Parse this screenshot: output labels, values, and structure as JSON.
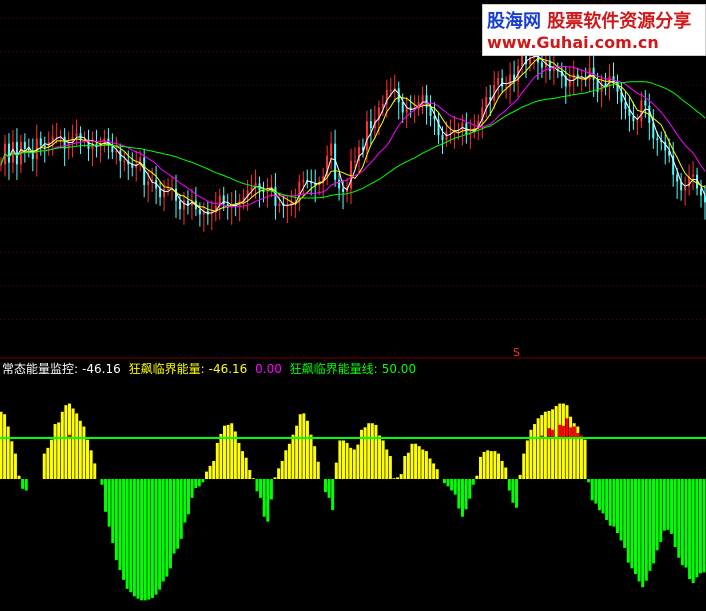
{
  "watermark": {
    "brand": "股海网",
    "tagline": "股票软件资源分享",
    "url": "www.Guhai.com.cn"
  },
  "signal_mark": "S",
  "legend": {
    "monitor_label": "常态能量监控:",
    "monitor_value": "-46.16",
    "critical_label": "狂飙临界能量:",
    "critical_value": "-46.16",
    "extra_value": "0.00",
    "line_label": "狂飙临界能量线:",
    "line_value": "50.00"
  },
  "colors": {
    "background": "#000000",
    "up_candle": "#ff3232",
    "down_candle": "#54ffff",
    "ma_short": "#ffffff",
    "ma_mid": "#ffff00",
    "ma_long1": "#ff00ff",
    "ma_long2": "#00ff00",
    "grid": "#5a0000",
    "positive_bar": "#ffff00",
    "negative_bar": "#00ff00",
    "exceed_bar": "#ff0000",
    "threshold_line": "#00ff00",
    "legend_monitor": "#ffffff",
    "legend_critical": "#ffff00",
    "legend_extra": "#ff00ff",
    "legend_line": "#00ff00"
  },
  "chart_data": [
    {
      "type": "candlestick",
      "title": "",
      "grid": true,
      "series": [
        {
          "name": "",
          "values": [
            76,
            100,
            78,
            102,
            76,
            102,
            94,
            92,
            82,
            106,
            98,
            96,
            102,
            108,
            108,
            108,
            94,
            102,
            108,
            112,
            104,
            104,
            94,
            100,
            96,
            100,
            106,
            98,
            90,
            92,
            80,
            80,
            76,
            72,
            76,
            84,
            52,
            56,
            58,
            48,
            38,
            48,
            48,
            48,
            34,
            24,
            34,
            28,
            34,
            24,
            18,
            22,
            18,
            20,
            28,
            40,
            30,
            26,
            30,
            28,
            34,
            38,
            46,
            50,
            54,
            46,
            44,
            48,
            50,
            28,
            30,
            28,
            28,
            32,
            32,
            56,
            58,
            56,
            54,
            52,
            54,
            62,
            86,
            100,
            58,
            48,
            44,
            48,
            80,
            80,
            96,
            92,
            126,
            118,
            128,
            142,
            146,
            162,
            162,
            164,
            148,
            136,
            142,
            140,
            140,
            148,
            156,
            142,
            132,
            128,
            110,
            104,
            114,
            114,
            116,
            116,
            124,
            110,
            114,
            118,
            126,
            142,
            154,
            150,
            168,
            176,
            166,
            166,
            180,
            172,
            190,
            204,
            192,
            200,
            210,
            194,
            188,
            196,
            184,
            186,
            184,
            178,
            166,
            174,
            180,
            176,
            176,
            174,
            188,
            174,
            160,
            170,
            166,
            178,
            172,
            160,
            148,
            140,
            132,
            126,
            126,
            150,
            144,
            124,
            106,
            104,
            102,
            92,
            86,
            64,
            56,
            46,
            50,
            62,
            64,
            48,
            40,
            32
          ]
        }
      ]
    },
    {
      "type": "bar",
      "title": "",
      "series": [
        {
          "name": "",
          "values": [
            82,
            79,
            64,
            46,
            31,
            4,
            -12,
            -14,
            0,
            0,
            0,
            0,
            31,
            38,
            48,
            67,
            69,
            82,
            90,
            92,
            86,
            80,
            71,
            64,
            48,
            35,
            19,
            0,
            -7,
            -40,
            -58,
            -78,
            -99,
            -111,
            -123,
            -134,
            -138,
            -143,
            -146,
            -148,
            -148,
            -147,
            -145,
            -141,
            -135,
            -125,
            -119,
            -109,
            -91,
            -85,
            -73,
            -53,
            -43,
            -23,
            -11,
            -9,
            -4,
            9,
            16,
            22,
            44,
            55,
            65,
            66,
            68,
            58,
            44,
            34,
            26,
            11,
            1,
            -15,
            -23,
            -46,
            -52,
            -25,
            2,
            13,
            22,
            35,
            43,
            54,
            65,
            79,
            80,
            71,
            54,
            40,
            21,
            0,
            -16,
            -23,
            -38,
            20,
            47,
            47,
            44,
            38,
            36,
            42,
            60,
            63,
            68,
            68,
            66,
            53,
            47,
            36,
            28,
            1,
            2,
            6,
            28,
            32,
            43,
            43,
            40,
            36,
            34,
            25,
            19,
            12,
            0,
            -5,
            -9,
            -14,
            -19,
            -36,
            -46,
            -37,
            -24,
            -7,
            4,
            27,
            33,
            35,
            34,
            34,
            31,
            22,
            14,
            -14,
            -29,
            -35,
            5,
            31,
            47,
            60,
            67,
            74,
            78,
            82,
            83,
            85,
            89,
            92,
            92,
            90,
            76,
            68,
            64,
            52,
            48,
            -4,
            -26,
            -30,
            -38,
            -42,
            -50,
            -57,
            -58,
            -66,
            -75,
            -84,
            -102,
            -109,
            -116,
            -125,
            -132,
            -124,
            -112,
            -103,
            -87,
            -77,
            -63,
            -62,
            -67,
            -83,
            -96,
            -105,
            -108,
            -122,
            -127,
            -120,
            -115,
            -114
          ]
        },
        {
          "name": "",
          "values": [
            0,
            0,
            0,
            0,
            0,
            0,
            0,
            0,
            0,
            0,
            0,
            0,
            0,
            0,
            0,
            0,
            0,
            0,
            0,
            4,
            0,
            0,
            0,
            0,
            0,
            0,
            0,
            0,
            0,
            0,
            0,
            0,
            0,
            0,
            0,
            0,
            0,
            0,
            0,
            0,
            0,
            0,
            0,
            0,
            0,
            0,
            0,
            0,
            0,
            0,
            0,
            0,
            0,
            0,
            0,
            0,
            0,
            0,
            0,
            0,
            0,
            0,
            0,
            0,
            0,
            0,
            0,
            0,
            0,
            0,
            0,
            0,
            0,
            0,
            0,
            0,
            0,
            0,
            0,
            0,
            0,
            0,
            0,
            0,
            0,
            0,
            0,
            0,
            0,
            0,
            0,
            0,
            0,
            0,
            0,
            0,
            0,
            0,
            0,
            0,
            0,
            0,
            0,
            0,
            0,
            0,
            0,
            0,
            0,
            0,
            0,
            0,
            0,
            0,
            0,
            0,
            0,
            0,
            0,
            0,
            0,
            0,
            0,
            0,
            0,
            0,
            0,
            0,
            0,
            0,
            0,
            0,
            0,
            0,
            0,
            0,
            0,
            0,
            0,
            0,
            0,
            0,
            0,
            0,
            0,
            0,
            0,
            0,
            0,
            0,
            3,
            0,
            12,
            10,
            0,
            16,
            15,
            24,
            13,
            14,
            6,
            3,
            0,
            0,
            0,
            0,
            0,
            0,
            0,
            0,
            0,
            0,
            0,
            0,
            0,
            0,
            0,
            0,
            0,
            0,
            0,
            0,
            0,
            0,
            0,
            0,
            0,
            0,
            0,
            0,
            0,
            0,
            0,
            0,
            0,
            0,
            0,
            0,
            0,
            0,
            0
          ]
        }
      ],
      "threshold": 50,
      "ylim": [
        -150,
        105
      ]
    }
  ]
}
